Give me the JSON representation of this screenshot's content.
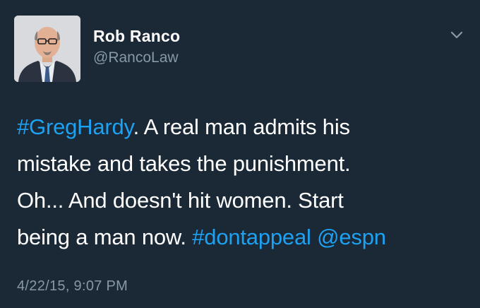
{
  "author": {
    "display_name": "Rob Ranco",
    "handle": "@RancoLaw"
  },
  "menu": {
    "icon": "chevron-down-icon"
  },
  "tweet": {
    "line1_tag": "#GregHardy",
    "line1_text": ". A real man admits his",
    "line2_text": "mistake and takes the punishment.",
    "line3_text": "Oh... And doesn't hit women. Start",
    "line4_text": "being a man now.",
    "hashtag_dontappeal": "#dontappeal",
    "mention_espn": "@espn"
  },
  "timestamp": "4/22/15, 9:07 PM",
  "colors": {
    "background": "#1b2836",
    "link": "#1da1f2",
    "secondary_text": "#8899a6"
  }
}
